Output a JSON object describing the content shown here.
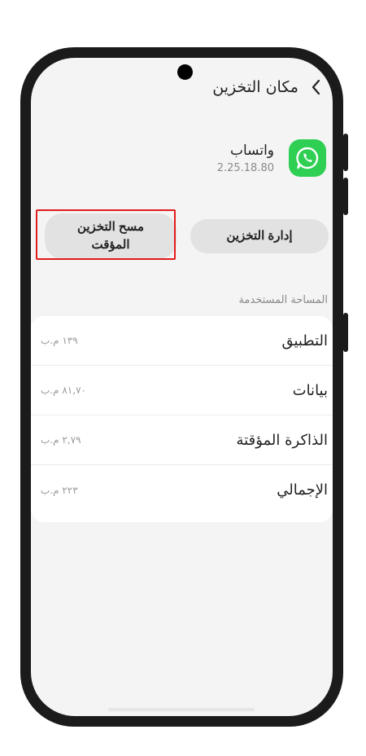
{
  "header": {
    "title": "مكان التخزين",
    "back_icon": "chevron-left-icon"
  },
  "app": {
    "name": "واتساب",
    "version": "2.25.18.80",
    "icon": "whatsapp-icon",
    "icon_color": "#2fcf54"
  },
  "buttons": {
    "manage_storage": "إدارة التخزين",
    "clear_cache": "مسح التخزين المؤقت"
  },
  "highlight_color": "#e11b1b",
  "section": {
    "label": "المساحة المستخدمة"
  },
  "storage": [
    {
      "label": "التطبيق",
      "value": "١٣٩ م.ب"
    },
    {
      "label": "بيانات",
      "value": "٨١,٧٠ م.ب"
    },
    {
      "label": "الذاكرة المؤقتة",
      "value": "٢,٧٩ م.ب"
    },
    {
      "label": "الإجمالي",
      "value": "٢٢٣ م.ب"
    }
  ]
}
